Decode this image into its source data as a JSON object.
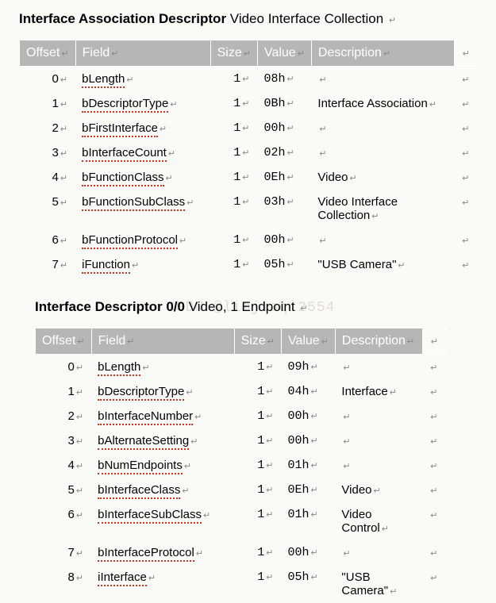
{
  "section1": {
    "title_bold": "Interface Association Descriptor",
    "title_light": "Video Interface Collection",
    "headers": {
      "offset": "Offset",
      "field": "Field",
      "size": "Size",
      "value": "Value",
      "description": "Description"
    },
    "rows": [
      {
        "offset": "0",
        "field": "bLength",
        "size": "1",
        "value": "08h",
        "description": ""
      },
      {
        "offset": "1",
        "field": "bDescriptorType",
        "size": "1",
        "value": "0Bh",
        "description": "Interface Association"
      },
      {
        "offset": "2",
        "field": "bFirstInterface",
        "size": "1",
        "value": "00h",
        "description": ""
      },
      {
        "offset": "3",
        "field": "bInterfaceCount",
        "size": "1",
        "value": "02h",
        "description": ""
      },
      {
        "offset": "4",
        "field": "bFunctionClass",
        "size": "1",
        "value": "0Eh",
        "description": "Video"
      },
      {
        "offset": "5",
        "field": "bFunctionSubClass",
        "size": "1",
        "value": "03h",
        "description": "Video Interface Collection"
      },
      {
        "offset": "6",
        "field": "bFunctionProtocol",
        "size": "1",
        "value": "00h",
        "description": ""
      },
      {
        "offset": "7",
        "field": "iFunction",
        "size": "1",
        "value": "05h",
        "description": "\"USB Camera\""
      }
    ]
  },
  "section2": {
    "title_bold": "Interface Descriptor 0/0",
    "title_light": "Video, 1 Endpoint",
    "headers": {
      "offset": "Offset",
      "field": "Field",
      "size": "Size",
      "value": "Value",
      "description": "Description"
    },
    "rows": [
      {
        "offset": "0",
        "field": "bLength",
        "size": "1",
        "value": "09h",
        "description": ""
      },
      {
        "offset": "1",
        "field": "bDescriptorType",
        "size": "1",
        "value": "04h",
        "description": "Interface"
      },
      {
        "offset": "2",
        "field": "bInterfaceNumber",
        "size": "1",
        "value": "00h",
        "description": ""
      },
      {
        "offset": "3",
        "field": "bAlternateSetting",
        "size": "1",
        "value": "00h",
        "description": ""
      },
      {
        "offset": "4",
        "field": "bNumEndpoints",
        "size": "1",
        "value": "01h",
        "description": ""
      },
      {
        "offset": "5",
        "field": "bInterfaceClass",
        "size": "1",
        "value": "0Eh",
        "description": "Video"
      },
      {
        "offset": "6",
        "field": "bInterfaceSubClass",
        "size": "1",
        "value": "01h",
        "description": "Video Control"
      },
      {
        "offset": "7",
        "field": "bInterfaceProtocol",
        "size": "1",
        "value": "00h",
        "description": ""
      },
      {
        "offset": "8",
        "field": "iInterface",
        "size": "1",
        "value": "05h",
        "description": "\"USB Camera\""
      }
    ]
  },
  "watermark": "CSDN @limjiaqi2554",
  "mark_glyph": "↵"
}
